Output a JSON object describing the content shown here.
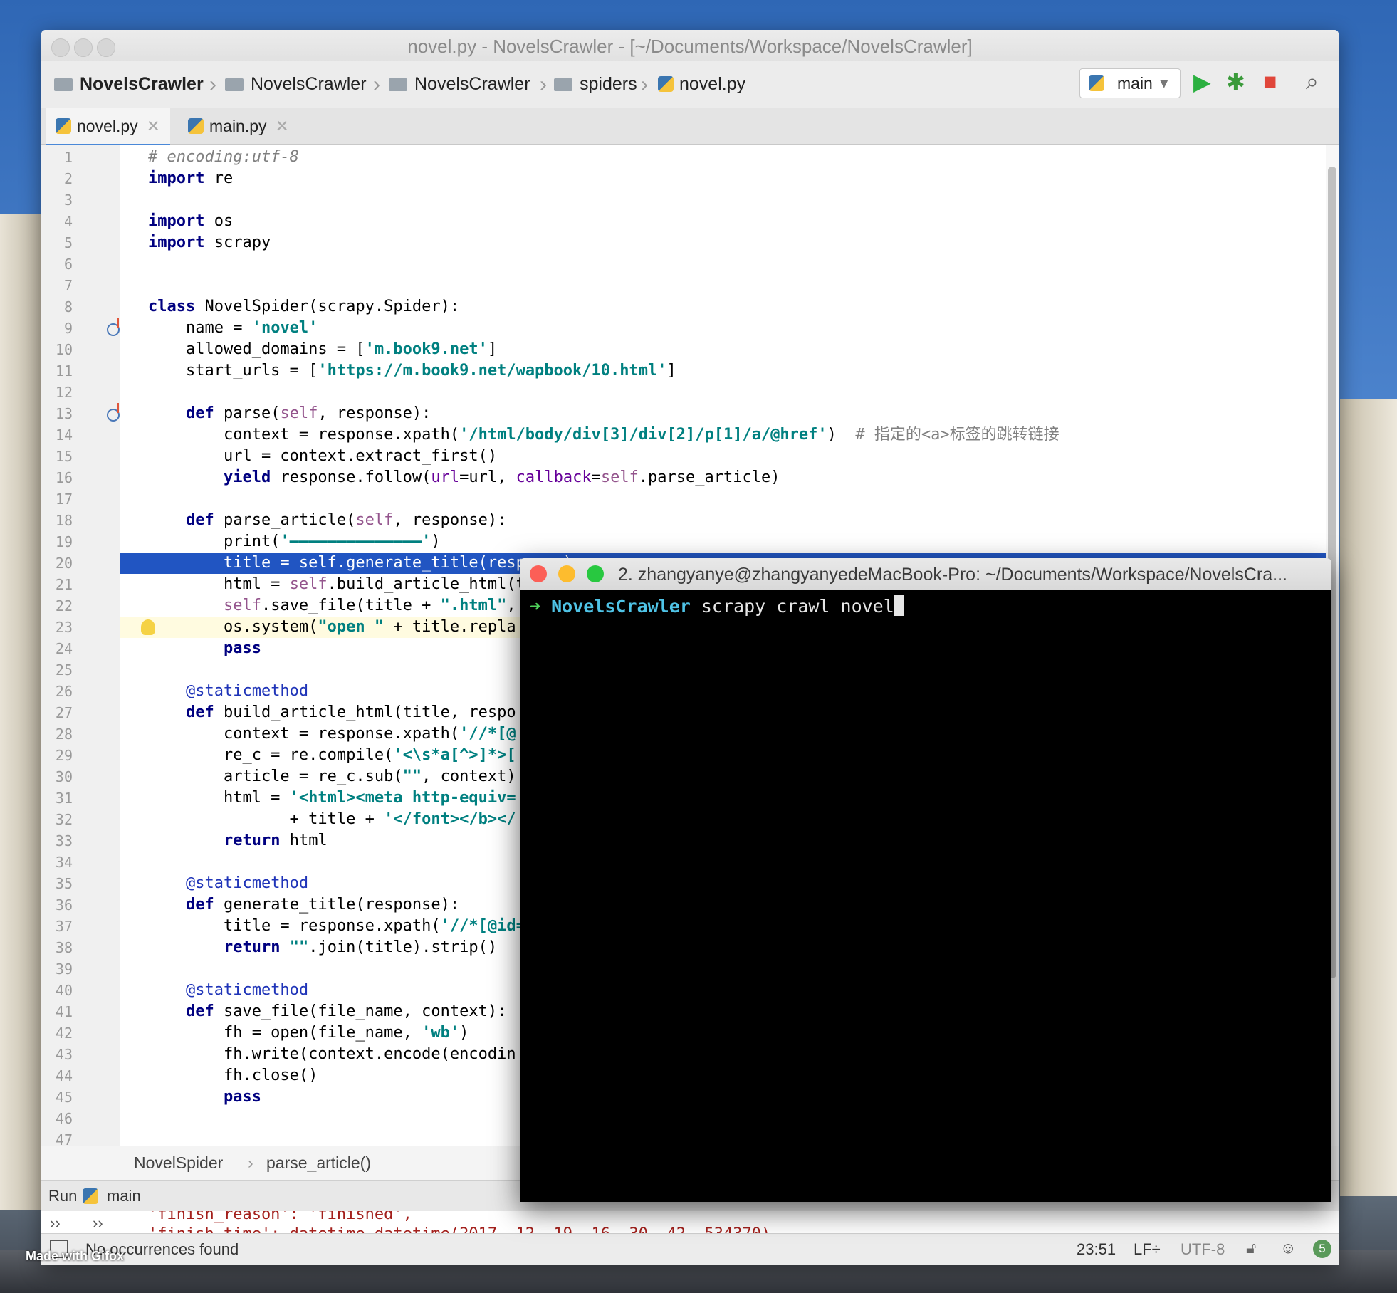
{
  "window_title": "novel.py - NovelsCrawler - [~/Documents/Workspace/NovelsCrawler]",
  "breadcrumbs": [
    "NovelsCrawler",
    "NovelsCrawler",
    "NovelsCrawler",
    "spiders",
    "novel.py"
  ],
  "run_config": "main",
  "tabs": [
    {
      "label": "novel.py",
      "active": true
    },
    {
      "label": "main.py",
      "active": false
    }
  ],
  "code_lines": [
    "# encoding:utf-8",
    "import re",
    "",
    "import os",
    "import scrapy",
    "",
    "",
    "class NovelSpider(scrapy.Spider):",
    "    name = 'novel'",
    "    allowed_domains = ['m.book9.net']",
    "    start_urls = ['https://m.book9.net/wapbook/10.html']",
    "",
    "    def parse(self, response):",
    "        context = response.xpath('/html/body/div[3]/div[2]/p[1]/a/@href')  # 指定的<a>标签的跳转链接",
    "        url = context.extract_first()",
    "        yield response.follow(url=url, callback=self.parse_article)",
    "",
    "    def parse_article(self, response):",
    "        print('——————————————')",
    "        title = self.generate_title(response)",
    "        html = self.build_article_html(t",
    "        self.save_file(title + \".html\",",
    "        os.system(\"open \" + title.repla",
    "        pass",
    "",
    "    @staticmethod",
    "    def build_article_html(title, respo",
    "        context = response.xpath('//*[@",
    "        re_c = re.compile('<\\s*a[^>]*>[",
    "        article = re_c.sub(\"\", context)",
    "        html = '<html><meta http-equiv=",
    "               + title + '</font></b></",
    "        return html",
    "",
    "    @staticmethod",
    "    def generate_title(response):",
    "        title = response.xpath('//*[@id=",
    "        return \"\".join(title).strip()",
    "",
    "    @staticmethod",
    "    def save_file(file_name, context):",
    "        fh = open(file_name, 'wb')",
    "        fh.write(context.encode(encodin",
    "        fh.close()",
    "        pass",
    "",
    ""
  ],
  "highlighted_line": 20,
  "current_line": 23,
  "structure_path": [
    "NovelSpider",
    "parse_article()"
  ],
  "run_panel": {
    "label": "Run",
    "config": "main",
    "output": [
      "'finish_reason': 'finished',",
      "'finish_time': datetime.datetime(2017, 12, 19, 16, 30, 42, 534370),"
    ]
  },
  "status": {
    "message": "No occurrences found",
    "position": "23:51",
    "line_sep": "LF÷",
    "encoding": "UTF-8",
    "badge": "5"
  },
  "terminal": {
    "title": "2. zhangyanye@zhangyanyedeMacBook-Pro: ~/Documents/Workspace/NovelsCra...",
    "prompt_arrow": "➜",
    "prompt_dir": "NovelsCrawler",
    "command": "scrapy crawl novel"
  },
  "watermark": "Made with Gifox"
}
